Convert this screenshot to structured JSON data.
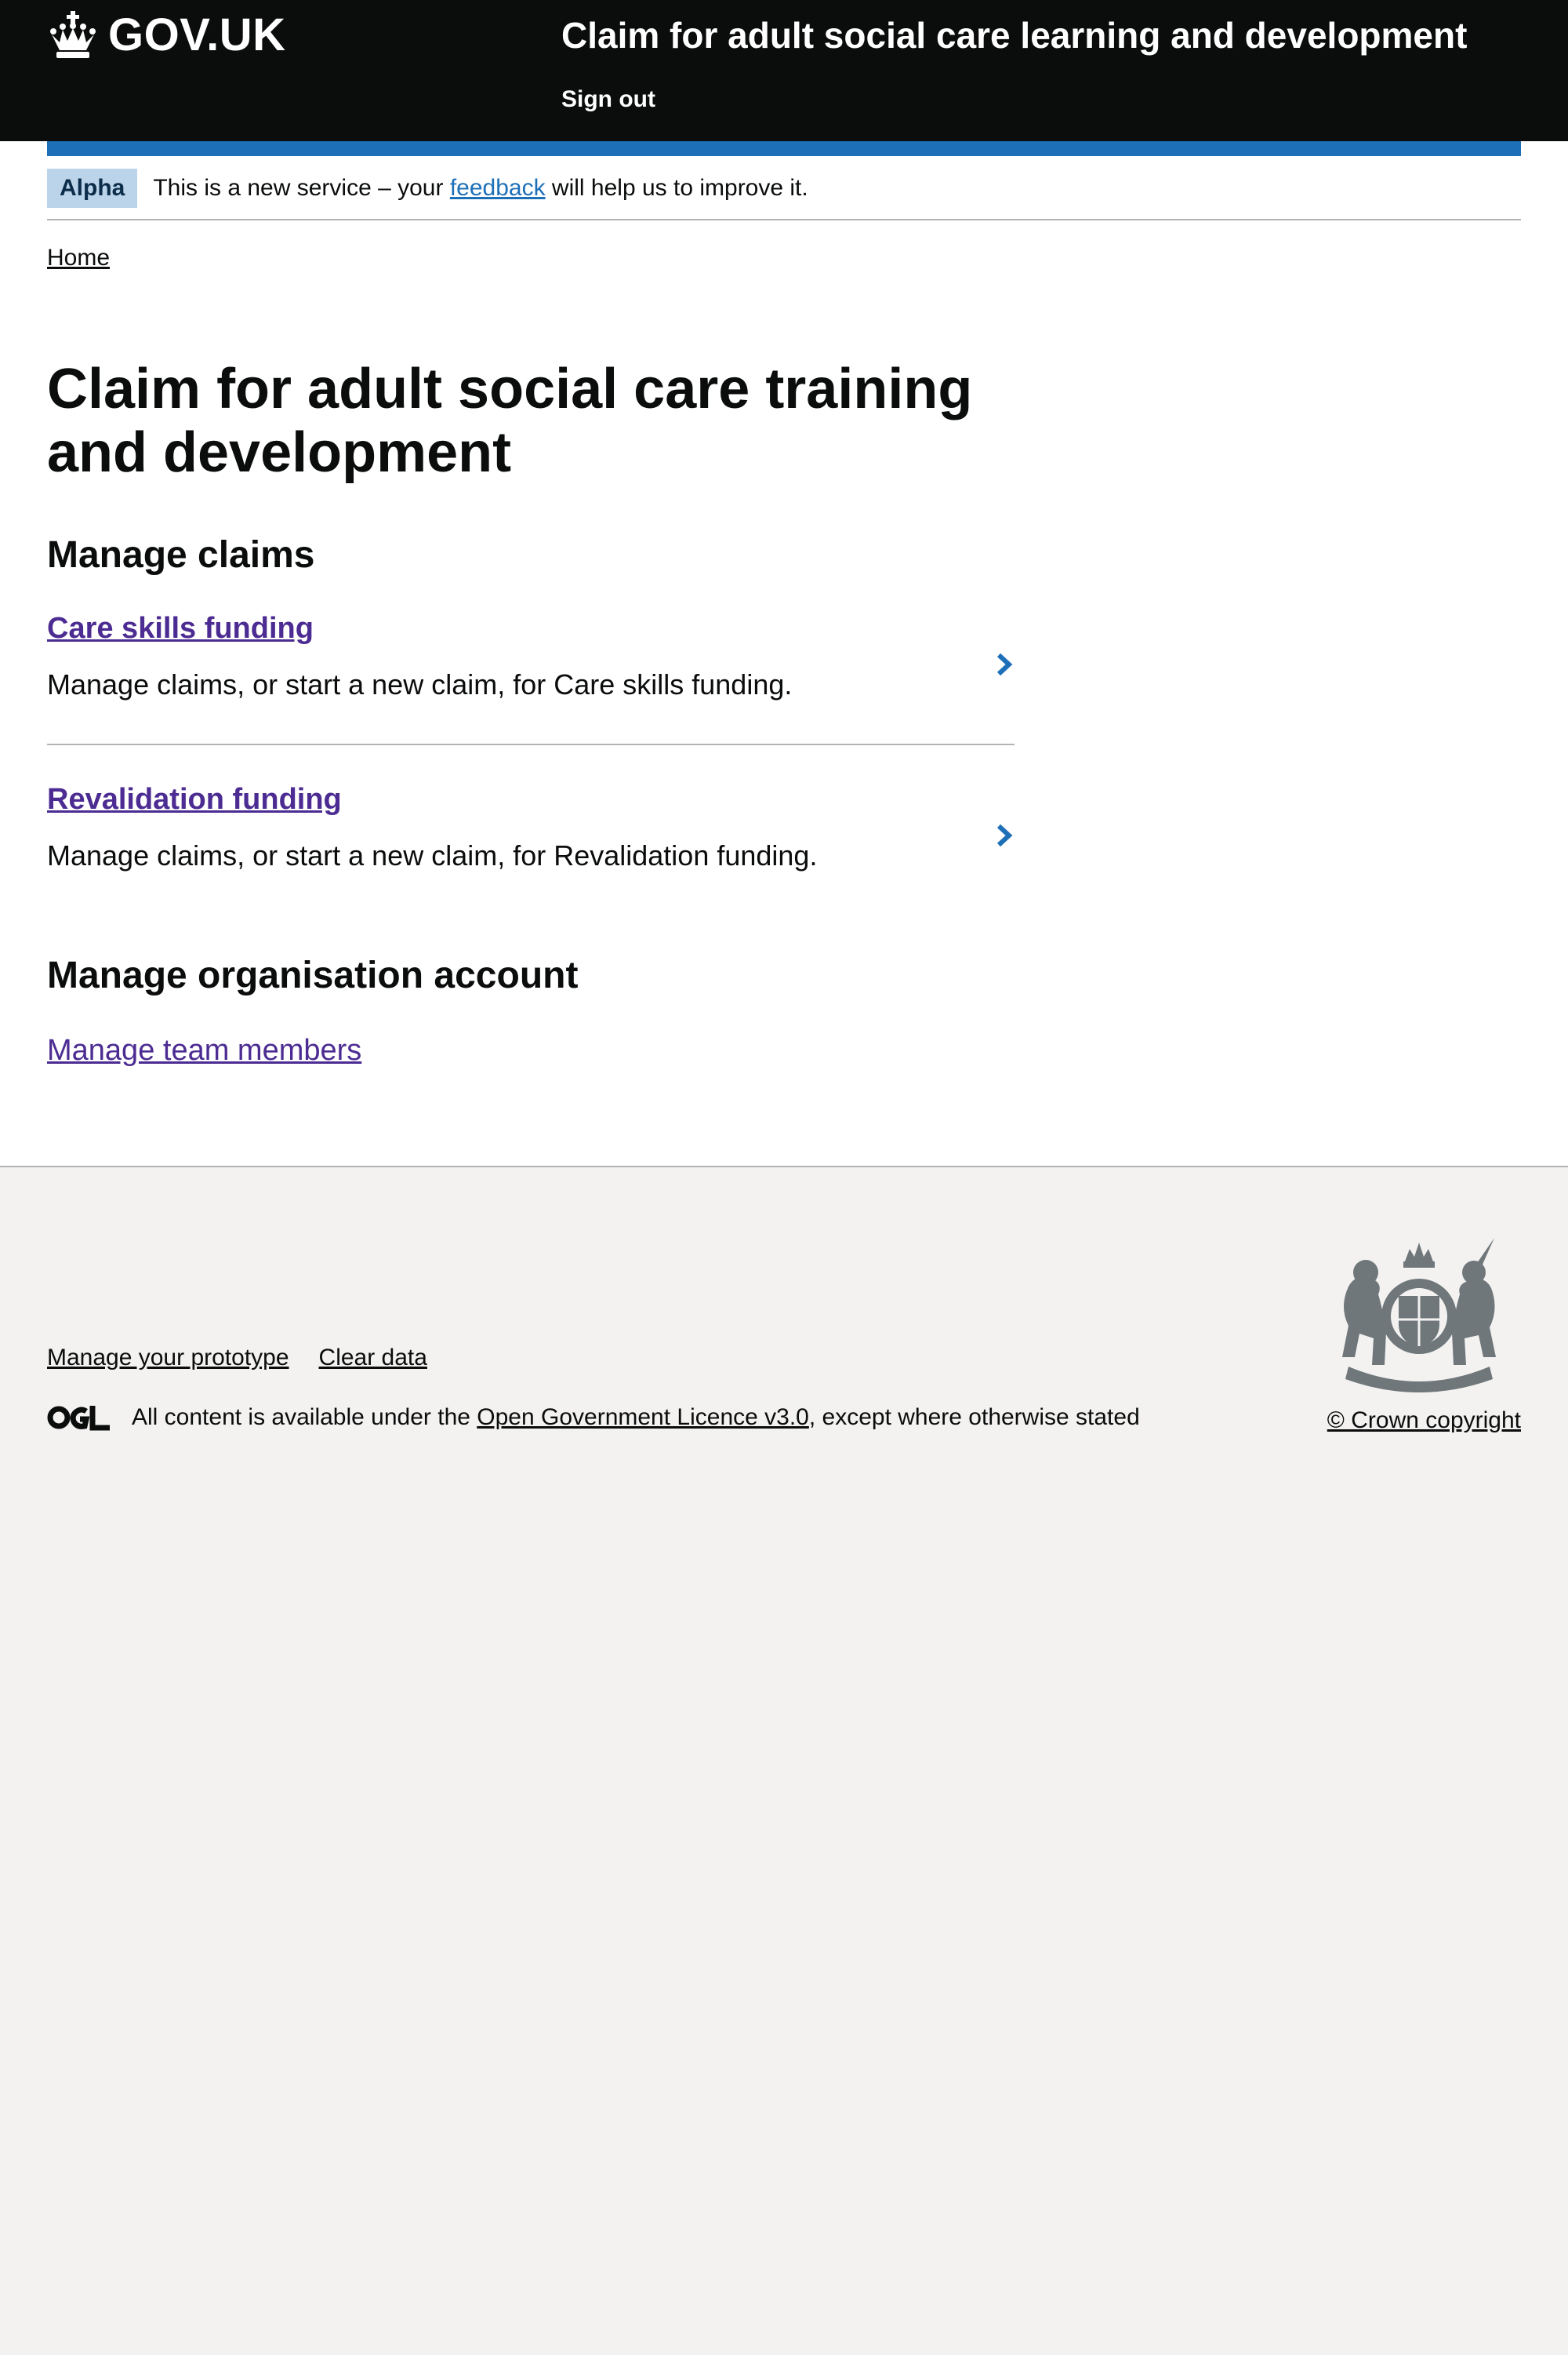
{
  "header": {
    "logo_text": "GOV.UK",
    "service_name": "Claim for adult social care learning and development",
    "sign_out": "Sign out"
  },
  "phase_banner": {
    "tag": "Alpha",
    "text_before": "This is a new service – your ",
    "link": "feedback",
    "text_after": " will help us to improve it."
  },
  "breadcrumb": {
    "home": "Home"
  },
  "main": {
    "title": "Claim for adult social care training and development",
    "manage_claims_heading": "Manage claims",
    "cards": [
      {
        "title": "Care skills funding",
        "description": "Manage claims, or start a new claim, for Care skills funding."
      },
      {
        "title": "Revalidation funding",
        "description": "Manage claims, or start a new claim, for Revalidation funding."
      }
    ],
    "org_heading": "Manage organisation account",
    "team_link": "Manage team members"
  },
  "footer": {
    "links": [
      "Manage your prototype",
      "Clear data"
    ],
    "licence_before": "All content is available under the ",
    "licence_link": "Open Government Licence v3.0",
    "licence_after": ", except where otherwise stated",
    "copyright": "© Crown copyright"
  },
  "colors": {
    "header_bg": "#0b0c0c",
    "brand_blue": "#1d70b8",
    "visited_link": "#4c2c92",
    "footer_bg": "#f3f2f1",
    "tag_bg": "#bbd4ea"
  },
  "icons": [
    "crown-icon",
    "chevron-right-icon",
    "ogl-logo-icon",
    "royal-crest-icon"
  ]
}
